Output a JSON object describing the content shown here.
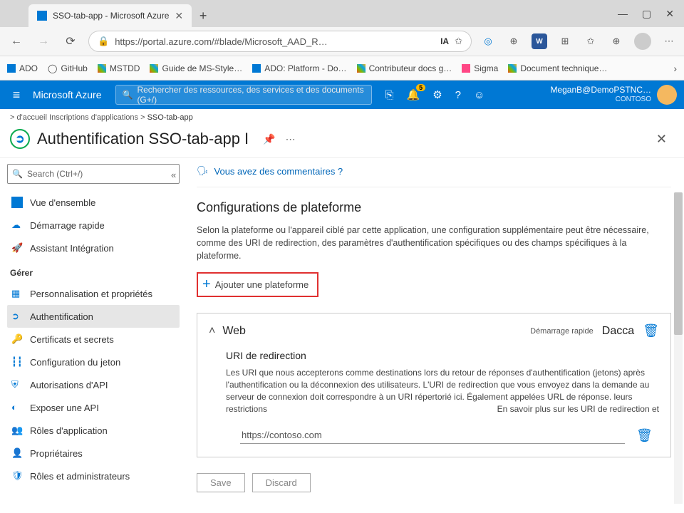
{
  "browser": {
    "tab_title": "SSO-tab-app - Microsoft Azure",
    "url": "https://portal.azure.com/#blade/Microsoft_AAD_R…",
    "ia_label": "IA",
    "bookmarks": [
      {
        "label": "ADO",
        "color": "#0078d4"
      },
      {
        "label": "GitHub",
        "color": "#111"
      },
      {
        "label": "MSTDD",
        "color": "#e81123"
      },
      {
        "label": "Guide de MS-Style…",
        "color": "#e81123"
      },
      {
        "label": "ADO: Platform - Do…",
        "color": "#0078d4"
      },
      {
        "label": "Contributeur docs g…",
        "color": "#e81123"
      },
      {
        "label": "Sigma",
        "color": "#ff4785"
      },
      {
        "label": "Document technique…",
        "color": "#e81123"
      }
    ]
  },
  "azure": {
    "brand": "Microsoft Azure",
    "search_placeholder": "Rechercher des ressources, des services et des documents (G+/)",
    "notif_count": "5",
    "account_name": "MeganB@DemoPSTNC…",
    "account_org": "CONTOSO"
  },
  "crumbs": {
    "c1": "> d'accueil",
    "c2": "Inscriptions d'applications >",
    "c3": "SSO-tab-app"
  },
  "page": {
    "title": "Authentification SSO-tab-app I"
  },
  "sidebar": {
    "search_placeholder": "Search (Ctrl+/)",
    "items_top": [
      {
        "label": "Vue d'ensemble"
      },
      {
        "label": "Démarrage rapide"
      },
      {
        "label": "Assistant Intégration"
      }
    ],
    "header": "Gérer",
    "items_manage": [
      {
        "label": "Personnalisation et propriétés"
      },
      {
        "label": "Authentification"
      },
      {
        "label": "Certificats et secrets"
      },
      {
        "label": "Configuration du jeton"
      },
      {
        "label": "Autorisations d'API"
      },
      {
        "label": "Exposer une API"
      },
      {
        "label": "Rôles d'application"
      },
      {
        "label": "Propriétaires"
      },
      {
        "label": "Rôles et administrateurs"
      }
    ]
  },
  "content": {
    "feedback": "Vous avez des commentaires ?",
    "section_title": "Configurations de plateforme",
    "section_desc": "Selon la plateforme ou l'appareil ciblé par cette application, une configuration supplémentaire peut être nécessaire, comme des URI de redirection, des paramètres d'authentification spécifiques ou des champs spécifiques à la plateforme.",
    "add_platform": "Ajouter une plateforme",
    "web": {
      "title": "Web",
      "quickstart": "Démarrage rapide",
      "docs": "Dacca",
      "redirect_title": "URI de redirection",
      "redirect_desc": "Les URI que nous accepterons comme destinations lors du retour de réponses d'authentification (jetons) après l'authentification ou la déconnexion des utilisateurs. L'URI de redirection que vous envoyez dans la demande au serveur de connexion doit correspondre à un URI répertorié ici. Également appelées URL de réponse. leurs restrictions",
      "redirect_more": "En savoir plus sur les URI de redirection et",
      "uri_value": "https://contoso.com"
    },
    "save": "Save",
    "discard": "Discard"
  }
}
